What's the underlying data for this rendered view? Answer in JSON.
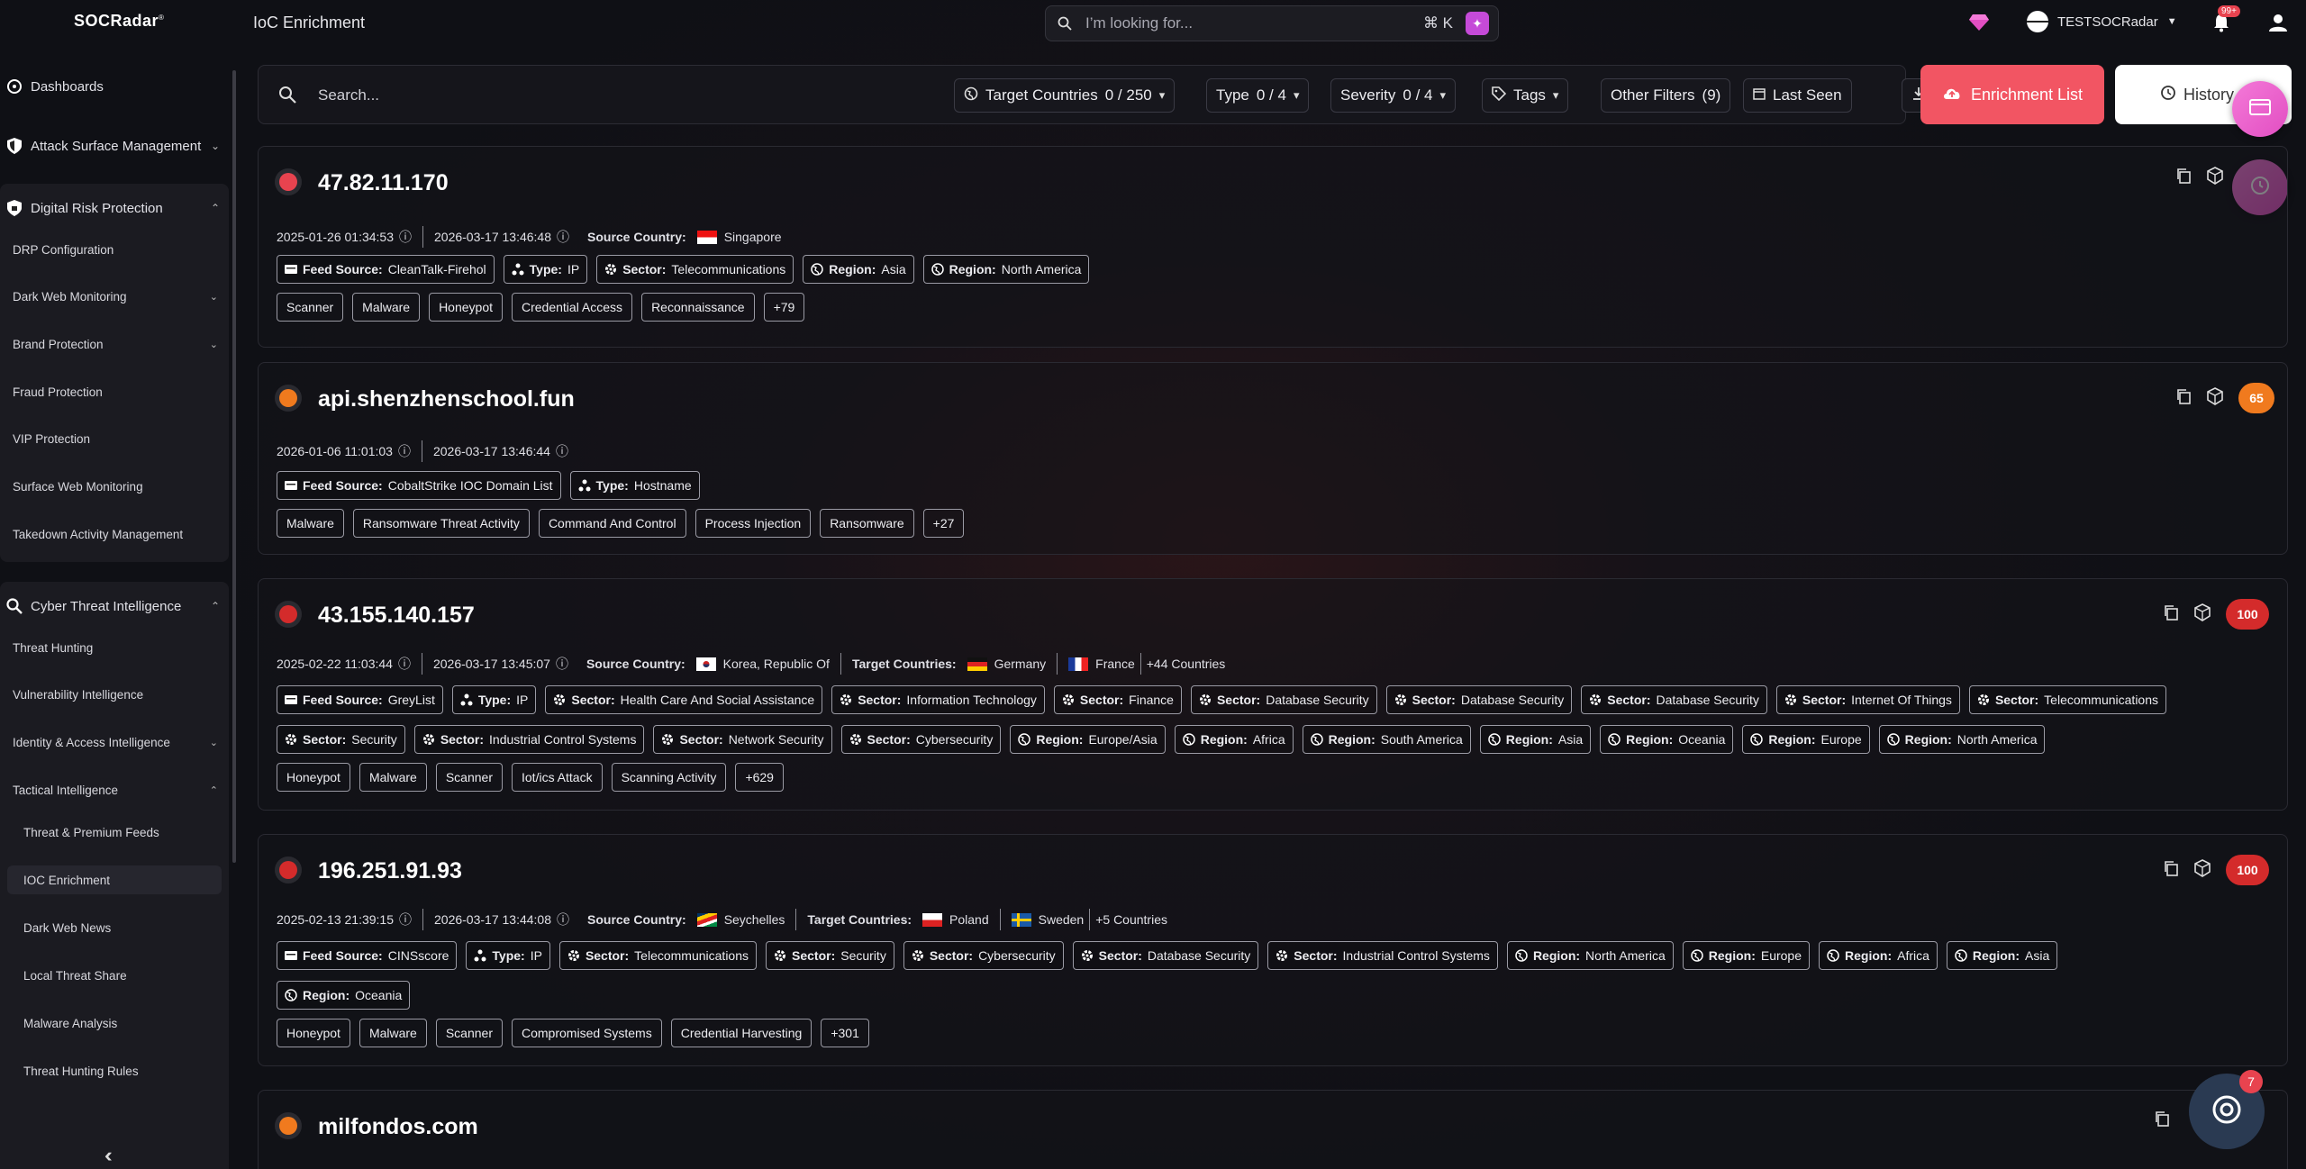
{
  "app": {
    "logo": "SOCRadar",
    "page_title": "IoC Enrichment"
  },
  "global_search": {
    "placeholder": "I’m looking for...",
    "shortcut": "⌘  K"
  },
  "user": {
    "name": "TESTSOCRadar",
    "notifications": "99+"
  },
  "sidebar": {
    "dashboards": "Dashboards",
    "asm": "Attack Surface Management",
    "drp": {
      "label": "Digital Risk Protection",
      "items": [
        "DRP Configuration",
        "Dark Web Monitoring",
        "Brand Protection",
        "Fraud Protection",
        "VIP Protection",
        "Surface Web Monitoring",
        "Takedown Activity Management"
      ]
    },
    "cti": {
      "label": "Cyber Threat Intelligence",
      "items": [
        "Threat Hunting",
        "Vulnerability Intelligence",
        "Identity & Access Intelligence",
        "Tactical Intelligence"
      ],
      "tactical": [
        "Threat & Premium Feeds",
        "IOC Enrichment",
        "Dark Web News",
        "Local Threat Share",
        "Malware Analysis",
        "Threat Hunting Rules"
      ]
    }
  },
  "filters": {
    "search_placeholder": "Search...",
    "target_countries": "Target Countries",
    "target_countries_count": "0 / 250",
    "type": "Type",
    "type_count": "0 / 4",
    "severity": "Severity",
    "severity_count": "0 / 4",
    "tags": "Tags",
    "other": "Other Filters",
    "other_count": "(9)",
    "last_seen": "Last Seen",
    "enrichment_list": "Enrichment List",
    "history": "History"
  },
  "cards": [
    {
      "ioc": "47.82.11.170",
      "sev_color": "#e8434f",
      "first": "2025-01-26 01:34:53",
      "last": "2026-03-17 13:46:48",
      "source_country_label": "Source Country:",
      "source_country": "Singapore",
      "chips": [
        [
          "Feed Source:",
          "CleanTalk-Firehol"
        ],
        [
          "Type:",
          "IP"
        ],
        [
          "Sector:",
          "Telecommunications"
        ],
        [
          "Region:",
          "Asia"
        ],
        [
          "Region:",
          "North America"
        ]
      ],
      "tags": [
        "Scanner",
        "Malware",
        "Honeypot",
        "Credential Access",
        "Reconnaissance",
        "+79"
      ]
    },
    {
      "ioc": "api.shenzhenschool.fun",
      "sev_color": "#f07a1e",
      "score": "65",
      "first": "2026-01-06 11:01:03",
      "last": "2026-03-17 13:46:44",
      "chips": [
        [
          "Feed Source:",
          "CobaltStrike IOC Domain List"
        ],
        [
          "Type:",
          "Hostname"
        ]
      ],
      "tags": [
        "Malware",
        "Ransomware Threat Activity",
        "Command And Control",
        "Process Injection",
        "Ransomware",
        "+27"
      ]
    },
    {
      "ioc": "43.155.140.157",
      "sev_color": "#d42b2b",
      "score": "100",
      "first": "2025-02-22 11:03:44",
      "last": "2026-03-17 13:45:07",
      "source_country_label": "Source Country:",
      "source_country": "Korea, Republic Of",
      "target_label": "Target Countries:",
      "targets": [
        "Germany",
        "France"
      ],
      "more_countries": "+44 Countries",
      "chips": [
        [
          "Feed Source:",
          "GreyList"
        ],
        [
          "Type:",
          "IP"
        ],
        [
          "Sector:",
          "Health Care And Social Assistance"
        ],
        [
          "Sector:",
          "Information Technology"
        ],
        [
          "Sector:",
          "Finance"
        ],
        [
          "Sector:",
          "Database Security"
        ],
        [
          "Sector:",
          "Database Security"
        ],
        [
          "Sector:",
          "Database Security"
        ],
        [
          "Sector:",
          "Internet Of Things"
        ],
        [
          "Sector:",
          "Telecommunications"
        ]
      ],
      "chips2": [
        [
          "Sector:",
          "Security"
        ],
        [
          "Sector:",
          "Industrial Control Systems"
        ],
        [
          "Sector:",
          "Network Security"
        ],
        [
          "Sector:",
          "Cybersecurity"
        ],
        [
          "Region:",
          "Europe/Asia"
        ],
        [
          "Region:",
          "Africa"
        ],
        [
          "Region:",
          "South America"
        ],
        [
          "Region:",
          "Asia"
        ],
        [
          "Region:",
          "Oceania"
        ],
        [
          "Region:",
          "Europe"
        ],
        [
          "Region:",
          "North America"
        ]
      ],
      "tags": [
        "Honeypot",
        "Malware",
        "Scanner",
        "Iot/ics Attack",
        "Scanning Activity",
        "+629"
      ]
    },
    {
      "ioc": "196.251.91.93",
      "sev_color": "#d42b2b",
      "score": "100",
      "first": "2025-02-13 21:39:15",
      "last": "2026-03-17 13:44:08",
      "source_country_label": "Source Country:",
      "source_country": "Seychelles",
      "target_label": "Target Countries:",
      "targets": [
        "Poland",
        "Sweden"
      ],
      "more_countries": "+5 Countries",
      "chips": [
        [
          "Feed Source:",
          "CINSscore"
        ],
        [
          "Type:",
          "IP"
        ],
        [
          "Sector:",
          "Telecommunications"
        ],
        [
          "Sector:",
          "Security"
        ],
        [
          "Sector:",
          "Cybersecurity"
        ],
        [
          "Sector:",
          "Database Security"
        ],
        [
          "Sector:",
          "Industrial Control Systems"
        ],
        [
          "Region:",
          "North America"
        ],
        [
          "Region:",
          "Europe"
        ],
        [
          "Region:",
          "Africa"
        ],
        [
          "Region:",
          "Asia"
        ]
      ],
      "chips2": [
        [
          "Region:",
          "Oceania"
        ]
      ],
      "tags": [
        "Honeypot",
        "Malware",
        "Scanner",
        "Compromised Systems",
        "Credential Harvesting",
        "+301"
      ]
    },
    {
      "ioc": "milfondos.com",
      "sev_color": "#f07a1e"
    }
  ],
  "chat_badge": "7",
  "colors": {
    "accent": "#f25563",
    "critical": "#d42b2b",
    "high": "#f07a1e"
  }
}
